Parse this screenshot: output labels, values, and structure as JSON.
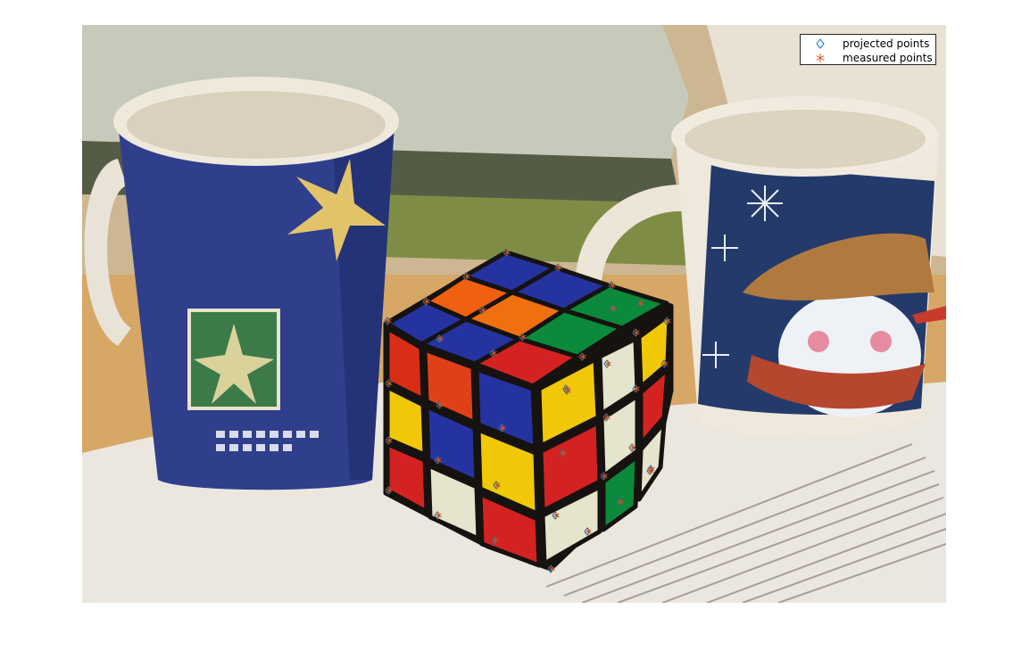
{
  "figure": {
    "legend": {
      "placement": "top-right",
      "entries": [
        {
          "label": "projected points",
          "marker": "diamond-marker",
          "color": "#0072BD"
        },
        {
          "label": "measured points",
          "marker": "asterisk-marker",
          "color": "#D95319"
        }
      ]
    },
    "photo": {
      "subject": "rubiks-cube-and-mugs",
      "colors": {
        "wall": "#cbb89a",
        "desk": "#d6a86a",
        "paper": "#ece8df",
        "mug_left_body": "#2f3f8c",
        "mug_right_body": "#f2ece2",
        "cube_red": "#d42222",
        "cube_orange": "#f06010",
        "cube_blue": "#2533a0",
        "cube_green": "#0a8a3a",
        "cube_yellow": "#f0c808",
        "cube_white": "#e6e4cc"
      }
    }
  }
}
